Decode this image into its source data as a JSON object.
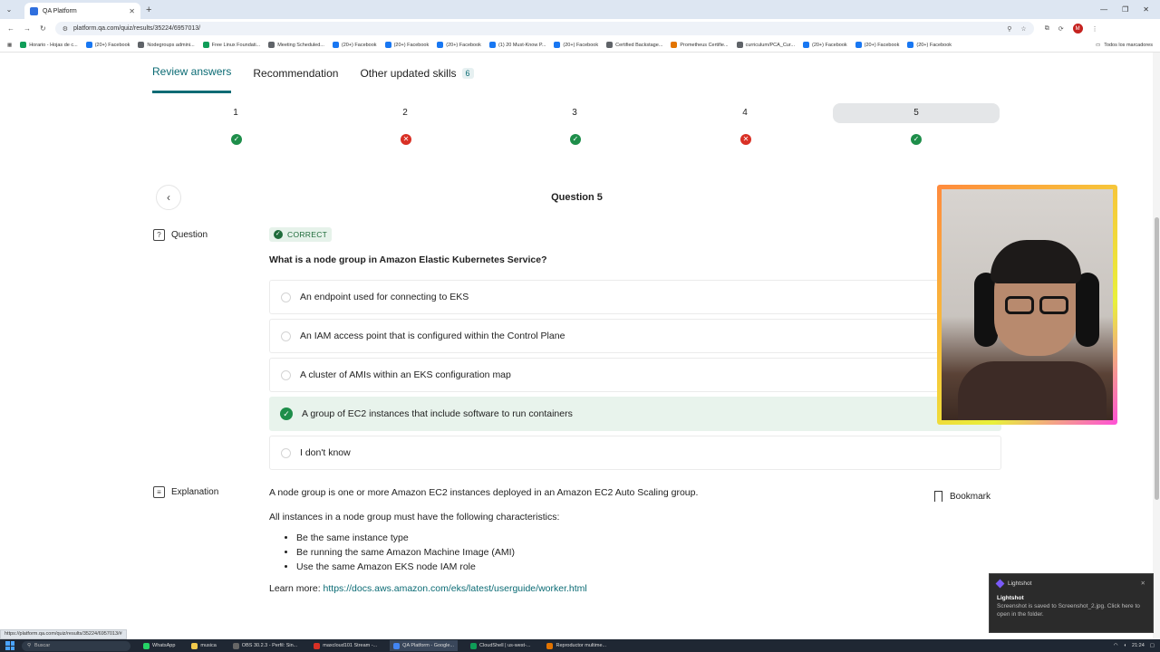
{
  "browser": {
    "tab_title": "QA Platform",
    "url": "platform.qa.com/quiz/results/35224/6957013/",
    "profile_initial": "M",
    "bookmarks": [
      {
        "label": "Horario - Hojas de c...",
        "kind": "g"
      },
      {
        "label": "(20+) Facebook",
        "kind": "f"
      },
      {
        "label": "Nodegroups admini...",
        "kind": "a"
      },
      {
        "label": "Free Linux Foundati...",
        "kind": "g"
      },
      {
        "label": "Meeting Scheduled...",
        "kind": "a"
      },
      {
        "label": "(20+) Facebook",
        "kind": "f"
      },
      {
        "label": "(20+) Facebook",
        "kind": "f"
      },
      {
        "label": "(20+) Facebook",
        "kind": "f"
      },
      {
        "label": "(1) 20 Must-Know P...",
        "kind": "f"
      },
      {
        "label": "(20+) Facebook",
        "kind": "f"
      },
      {
        "label": "Certified Backstage...",
        "kind": "a"
      },
      {
        "label": "Prometheus Certifie...",
        "kind": "o"
      },
      {
        "label": "curriculum/PCA_Cur...",
        "kind": "a"
      },
      {
        "label": "(20+) Facebook",
        "kind": "f"
      },
      {
        "label": "(20+) Facebook",
        "kind": "f"
      },
      {
        "label": "(20+) Facebook",
        "kind": "f"
      }
    ],
    "all_bookmarks": "Todos los marcadores",
    "status_url": "https://platform.qa.com/quiz/results/35224/6957013/#"
  },
  "tabs": [
    {
      "label": "Review answers",
      "active": true
    },
    {
      "label": "Recommendation",
      "active": false
    },
    {
      "label": "Other updated skills",
      "badge": "6",
      "active": false
    }
  ],
  "question_nav": [
    {
      "num": "1",
      "status": "correct"
    },
    {
      "num": "2",
      "status": "incorrect"
    },
    {
      "num": "3",
      "status": "correct"
    },
    {
      "num": "4",
      "status": "incorrect"
    },
    {
      "num": "5",
      "status": "correct",
      "active": true
    }
  ],
  "question": {
    "title": "Question 5",
    "side_label": "Question",
    "result": "CORRECT",
    "text": "What is a node group in Amazon Elastic Kubernetes Service?",
    "answers": [
      {
        "text": "An endpoint used for connecting to EKS",
        "selected": false
      },
      {
        "text": "An IAM access point that is configured within the Control Plane",
        "selected": false
      },
      {
        "text": "A cluster of AMIs within an EKS configuration map",
        "selected": false
      },
      {
        "text": "A group of EC2 instances that include software to run containers",
        "selected": true
      },
      {
        "text": "I don't know",
        "selected": false
      }
    ]
  },
  "explanation": {
    "side_label": "Explanation",
    "p1": "A node group is one or more Amazon EC2 instances deployed in an Amazon EC2 Auto Scaling group.",
    "p2": "All instances in a node group must have the following characteristics:",
    "bullets": [
      "Be the same instance type",
      "Be running the same Amazon Machine Image (AMI)",
      "Use the same Amazon EKS node IAM role"
    ],
    "learn_more_label": "Learn more: ",
    "learn_more_link": "https://docs.aws.amazon.com/eks/latest/userguide/worker.html",
    "bookmark_label": "Bookmark"
  },
  "toast": {
    "app": "Lightshot",
    "title": "Lightshot",
    "body": "Screenshot is saved to Screenshot_2.jpg. Click here to open in the folder."
  },
  "taskbar": {
    "search_placeholder": "Buscar",
    "tasks": [
      {
        "label": "WhatsApp",
        "color": "#25d366"
      },
      {
        "label": "musica",
        "color": "#f2c94c"
      },
      {
        "label": "OBS 30.2.3 - Perfil: Sin...",
        "color": "#444"
      },
      {
        "label": "maxcloud101 Stream -...",
        "color": "#d93025"
      },
      {
        "label": "QA Platform - Google...",
        "color": "#4285f4",
        "active": true
      },
      {
        "label": "CloudShell | us-west-...",
        "color": "#0f9d58"
      },
      {
        "label": "Reproductor multime...",
        "color": "#e37400"
      }
    ],
    "clock": "21:24"
  },
  "colors": {
    "accent": "#0b6b74",
    "correct": "#1e8e4a",
    "incorrect": "#d93025"
  }
}
